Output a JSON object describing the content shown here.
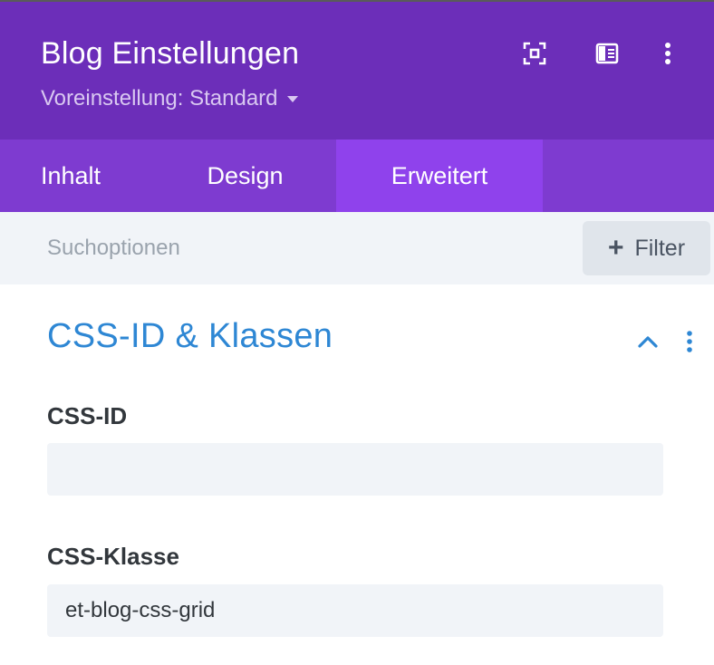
{
  "header": {
    "title": "Blog Einstellungen",
    "preset_label": "Voreinstellung: Standard",
    "icons": [
      "focus-icon",
      "sidebar-layout-icon",
      "more-vertical-icon"
    ]
  },
  "tabs": [
    {
      "label": "Inhalt",
      "active": false
    },
    {
      "label": "Design",
      "active": false
    },
    {
      "label": "Erweitert",
      "active": true
    }
  ],
  "toolbar": {
    "search_placeholder": "Suchoptionen",
    "filter_label": "Filter"
  },
  "section": {
    "title": "CSS-ID & Klassen",
    "expanded": true,
    "fields": [
      {
        "label": "CSS-ID",
        "value": ""
      },
      {
        "label": "CSS-Klasse",
        "value": "et-blog-css-grid"
      }
    ]
  },
  "colors": {
    "header_bg": "#6c2eb9",
    "tabs_bg": "#7e3bd0",
    "active_tab_bg": "#8f42ec",
    "accent_blue": "#2e87d4",
    "input_bg": "#f1f4f8"
  }
}
